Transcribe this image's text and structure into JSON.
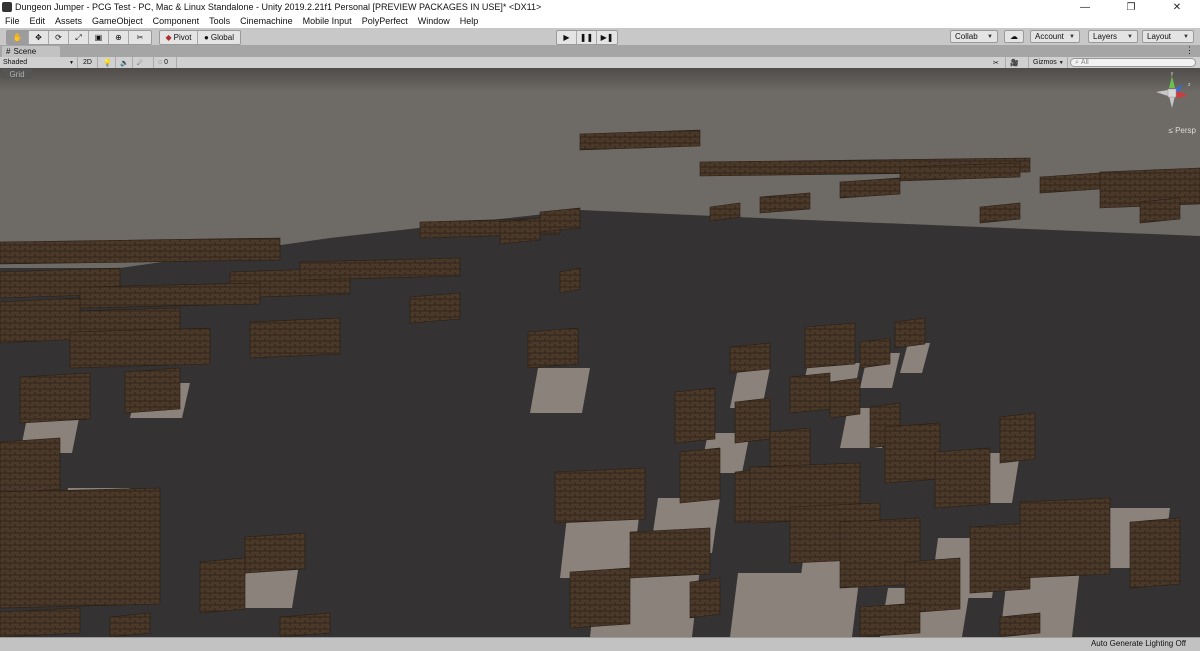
{
  "window": {
    "title": "Dungeon Jumper - PCG Test - PC, Mac & Linux Standalone - Unity 2019.2.21f1 Personal [PREVIEW PACKAGES IN USE]* <DX11>",
    "controls": [
      "—",
      "❐",
      "✕"
    ]
  },
  "menu": [
    "File",
    "Edit",
    "Assets",
    "GameObject",
    "Component",
    "Tools",
    "Cinemachine",
    "Mobile Input",
    "PolyPerfect",
    "Window",
    "Help"
  ],
  "toolbar": {
    "tools": [
      "✋",
      "✥",
      "⟳",
      "⤢",
      "▣",
      "⊕",
      "✂"
    ],
    "pivot_label": "Pivot",
    "global_label": "Global",
    "play_icons": [
      "▶",
      "❚❚",
      "▶❚"
    ],
    "collab_label": "Collab",
    "cloud_icon": "☁",
    "account_label": "Account",
    "layers_label": "Layers",
    "layout_label": "Layout"
  },
  "scene_tab": {
    "label": "Scene",
    "menu_icon": "⋮"
  },
  "scene_toolbar": {
    "shading_mode": "Shaded",
    "mode_2d": "2D",
    "light_icon": "💡",
    "audio_icon": "🔈",
    "effects_icon": "☄",
    "hidden_count": "0",
    "tools_icon": "✂",
    "camera_icon": "🎥",
    "gizmos_label": "Gizmos",
    "search_placeholder": "All"
  },
  "viewport": {
    "grid_label": "Grid",
    "projection_label": "Persp",
    "colors": {
      "sky": "#6e6a66",
      "floor": "#343232",
      "wall": "#4a3828",
      "tile": "#8a827b"
    }
  },
  "statusbar": {
    "lighting_label": "Auto Generate Lighting Off"
  }
}
